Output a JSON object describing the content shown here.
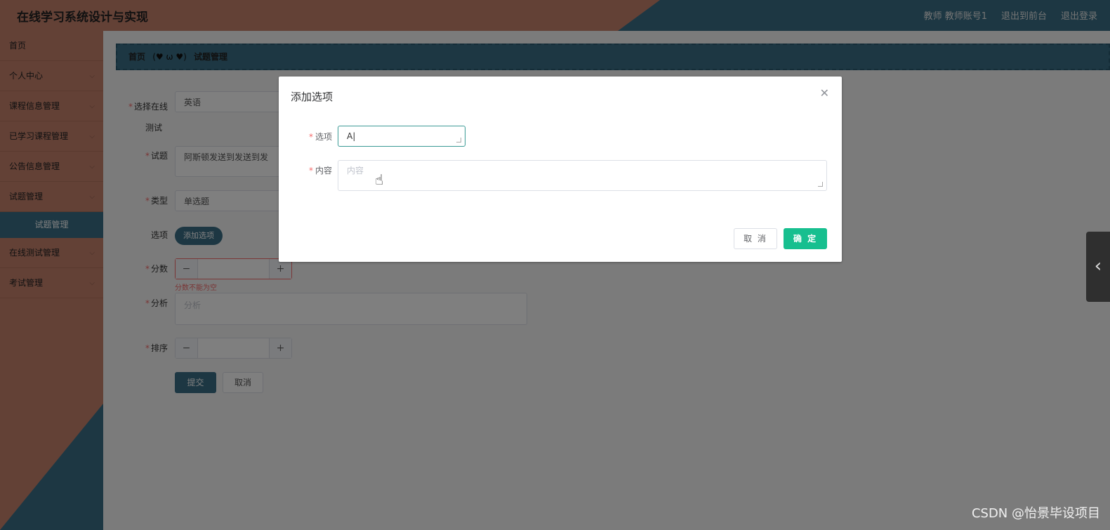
{
  "header": {
    "title": "在线学习系统设计与实现",
    "user_label": "教师 教师账号1",
    "to_front_label": "退出到前台",
    "logout_label": "退出登录"
  },
  "sidebar": {
    "items": [
      {
        "label": "首页"
      },
      {
        "label": "个人中心"
      },
      {
        "label": "课程信息管理"
      },
      {
        "label": "已学习课程管理"
      },
      {
        "label": "公告信息管理"
      },
      {
        "label": "试题管理"
      },
      {
        "label": "试题管理"
      },
      {
        "label": "在线测试管理"
      },
      {
        "label": "考试管理"
      }
    ]
  },
  "breadcrumb": {
    "home": "首页",
    "separator": "(♥ ω ♥)",
    "current": "试题管理"
  },
  "form": {
    "exam_label": "选择在线测试",
    "exam_label_1": "选择在线",
    "exam_label_2": "测试",
    "exam_value": "英语",
    "question_label": "试题",
    "question_value": "阿斯顿发送到发送到发",
    "type_label": "类型",
    "type_value": "单选题",
    "options_label": "选项",
    "add_option_label": "添加选项",
    "score_label": "分数",
    "score_error": "分数不能为空",
    "analysis_label": "分析",
    "analysis_placeholder": "分析",
    "order_label": "排序",
    "submit_label": "提交",
    "cancel_label": "取消"
  },
  "dialog": {
    "title": "添加选项",
    "option_label": "选项",
    "option_value": "A|",
    "content_label": "内容",
    "content_placeholder": "内容",
    "cancel_label": "取 消",
    "confirm_label": "确 定"
  },
  "watermark": "CSDN @怡景毕设项目"
}
